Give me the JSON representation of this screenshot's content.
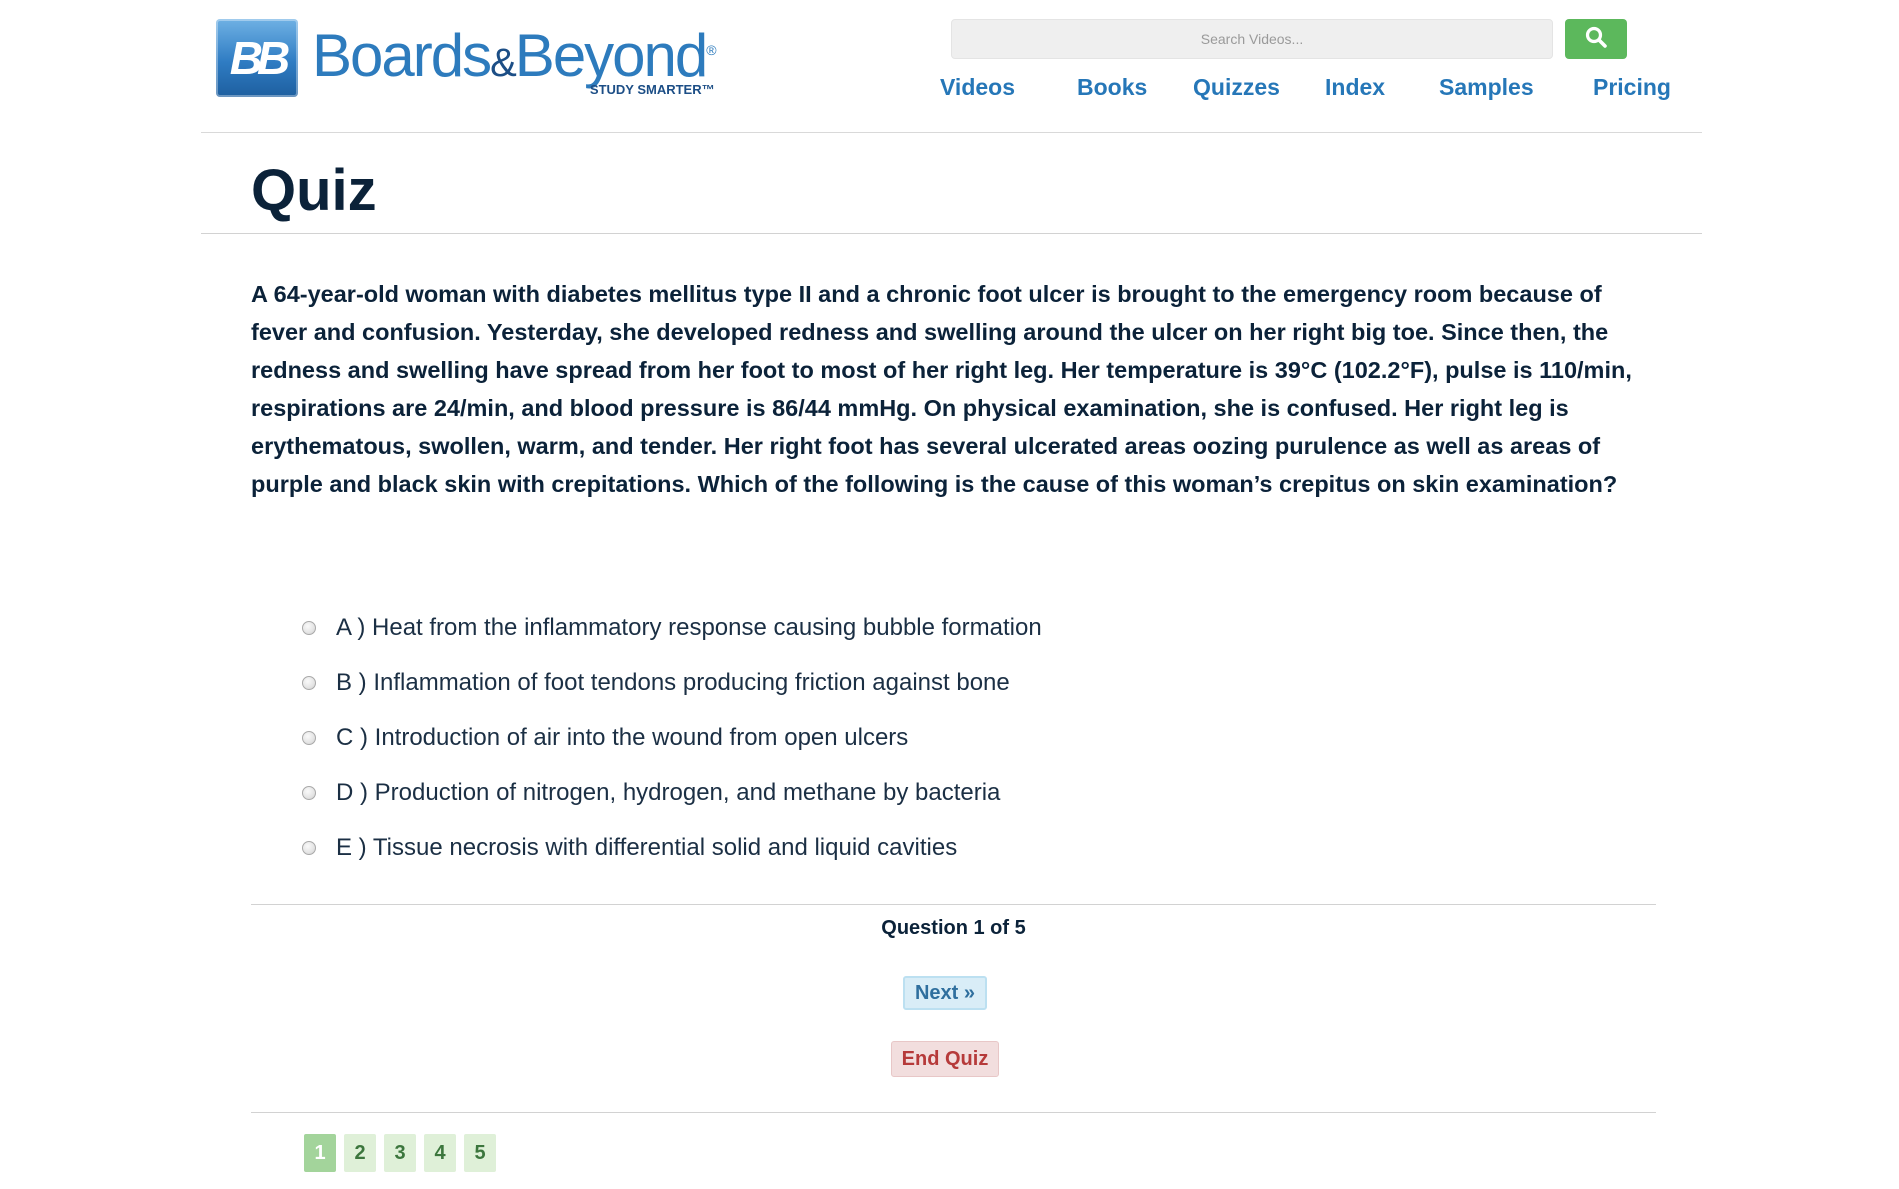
{
  "header": {
    "logo": {
      "badge_text": "BB",
      "brand_left": "Boards",
      "brand_amp": "&",
      "brand_right": "Beyond",
      "registered": "®",
      "tagline": "STUDY SMARTER™"
    },
    "search": {
      "placeholder": "Search Videos...",
      "button_icon": "search-icon"
    },
    "nav": [
      "Videos",
      "Books",
      "Quizzes",
      "Index",
      "Samples",
      "Pricing"
    ]
  },
  "page": {
    "title": "Quiz"
  },
  "question": {
    "text": "A 64-year-old woman with diabetes mellitus type II and a chronic foot ulcer is brought to the emergency room because of fever and confusion. Yesterday, she developed redness and swelling around the ulcer on her right big toe. Since then, the redness and swelling have spread from her foot to most of her right leg. Her temperature is 39°C (102.2°F), pulse is 110/min, respirations are 24/min, and blood pressure is 86/44 mmHg. On physical examination, she is confused. Her right leg is erythematous, swollen, warm, and tender. Her right foot has several ulcerated areas oozing purulence as well as areas of purple and black skin with crepitations. Which of the following is the cause of this woman’s crepitus on skin examination?",
    "options": [
      "A ) Heat from the inflammatory response causing bubble formation",
      "B ) Inflammation of foot tendons producing friction against bone",
      "C ) Introduction of air into the wound from open ulcers",
      "D ) Production of nitrogen, hydrogen, and methane by bacteria",
      "E ) Tissue necrosis with differential solid and liquid cavities"
    ]
  },
  "footer": {
    "counter": "Question 1 of 5",
    "next_label": "Next »",
    "end_label": "End Quiz",
    "pages": [
      "1",
      "2",
      "3",
      "4",
      "5"
    ],
    "active_page": "1"
  },
  "colors": {
    "brand_blue": "#2677b8",
    "heading": "#0b2239",
    "search_button": "#5cb85c",
    "next_bg": "#d9edf7",
    "end_bg": "#f2dede",
    "pager_bg": "#dff0d8"
  }
}
